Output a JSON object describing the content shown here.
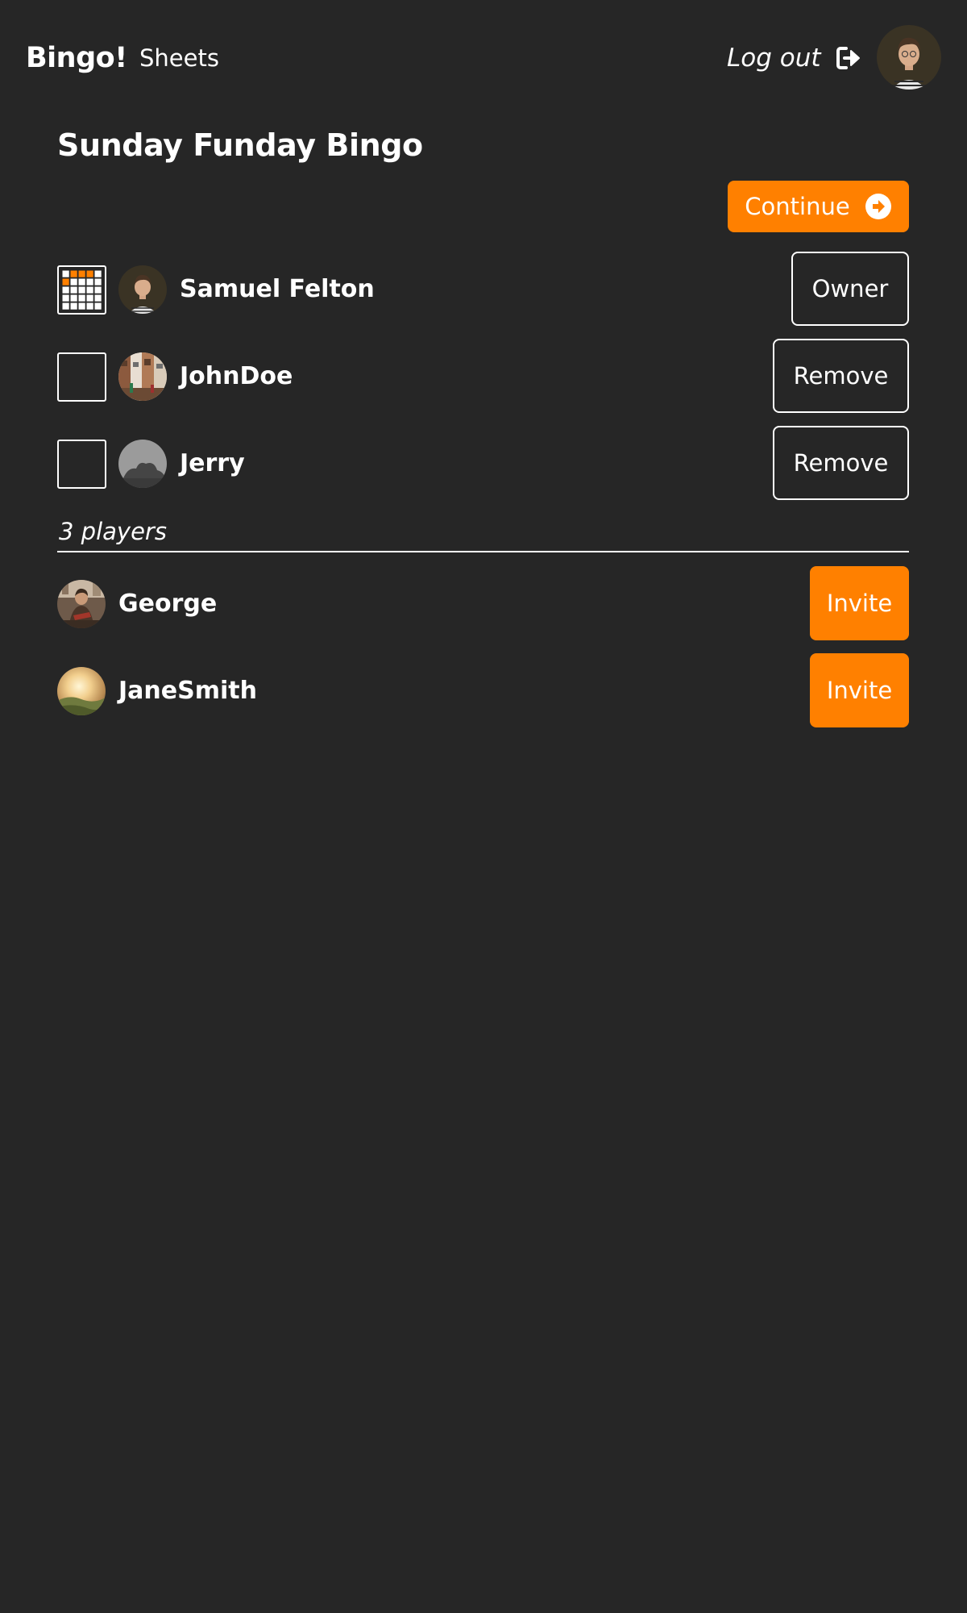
{
  "nav": {
    "brand": "Bingo!",
    "sheets_link": "Sheets",
    "logout_label": "Log out"
  },
  "page": {
    "title": "Sunday Funday Bingo",
    "continue_label": "Continue"
  },
  "players": [
    {
      "name": "Samuel Felton",
      "action": "Owner",
      "has_sheet": true
    },
    {
      "name": "JohnDoe",
      "action": "Remove",
      "has_sheet": false
    },
    {
      "name": "Jerry",
      "action": "Remove",
      "has_sheet": false
    }
  ],
  "player_count": "3 players",
  "invitees": [
    {
      "name": "George",
      "action": "Invite"
    },
    {
      "name": "JaneSmith",
      "action": "Invite"
    }
  ],
  "colors": {
    "background": "#262626",
    "accent": "#ff8000",
    "text": "#ffffff"
  },
  "icons": {
    "logout": "sign-out-arrow-icon",
    "continue": "arrow-circle-right-icon",
    "sheet": "bingo-grid-icon"
  }
}
